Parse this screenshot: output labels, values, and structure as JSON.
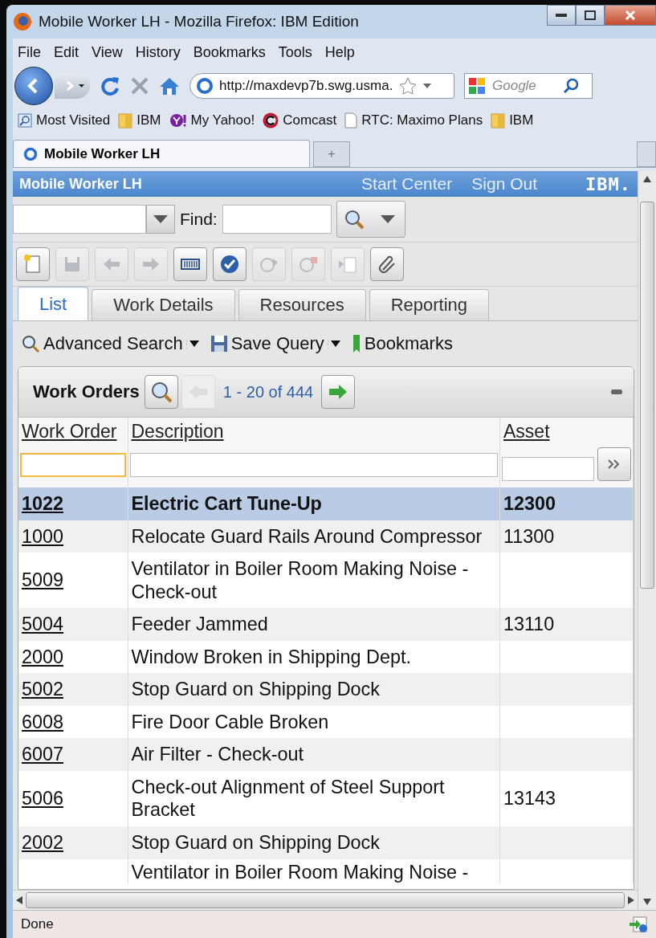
{
  "window": {
    "title": "Mobile Worker LH - Mozilla Firefox: IBM Edition"
  },
  "menu": [
    "File",
    "Edit",
    "View",
    "History",
    "Bookmarks",
    "Tools",
    "Help"
  ],
  "navigation": {
    "url": "http://maxdevp7b.swg.usma.",
    "search_placeholder": "Google"
  },
  "bookmarks": [
    {
      "label": "Most Visited",
      "kind": "smart"
    },
    {
      "label": "IBM",
      "kind": "folder"
    },
    {
      "label": "My Yahoo!",
      "kind": "yahoo"
    },
    {
      "label": "Comcast",
      "kind": "comcast"
    },
    {
      "label": "RTC: Maximo Plans",
      "kind": "page"
    },
    {
      "label": "IBM",
      "kind": "folder"
    }
  ],
  "browser_tab": {
    "title": "Mobile Worker LH",
    "new_tab": "+"
  },
  "app": {
    "title": "Mobile Worker LH",
    "links": [
      "Start Center",
      "Sign Out"
    ],
    "logo": "IBM."
  },
  "find": {
    "label": "Find:"
  },
  "toolbar": [
    {
      "kind": "new",
      "disabled": false
    },
    {
      "kind": "save",
      "disabled": true
    },
    {
      "kind": "back",
      "disabled": true
    },
    {
      "kind": "forward",
      "disabled": true
    },
    {
      "kind": "barcode",
      "disabled": false
    },
    {
      "kind": "check",
      "disabled": false
    },
    {
      "kind": "timer-start",
      "disabled": true
    },
    {
      "kind": "timer-stop",
      "disabled": true
    },
    {
      "kind": "duplicate",
      "disabled": true
    },
    {
      "kind": "attach",
      "disabled": false
    }
  ],
  "tabs": [
    {
      "label": "List",
      "selected": true
    },
    {
      "label": "Work Details",
      "selected": false
    },
    {
      "label": "Resources",
      "selected": false
    },
    {
      "label": "Reporting",
      "selected": false
    }
  ],
  "actions": [
    {
      "label": "Advanced Search",
      "kind": "search"
    },
    {
      "label": "Save Query",
      "kind": "save"
    },
    {
      "label": "Bookmarks",
      "kind": "bookmark"
    }
  ],
  "table": {
    "title": "Work Orders",
    "paging": "1 - 20 of 444",
    "columns": [
      "Work Order",
      "Description",
      "Asset"
    ],
    "rows": [
      {
        "work_order": "1022",
        "description": "Electric Cart Tune-Up",
        "asset": "12300",
        "selected": true
      },
      {
        "work_order": "1000",
        "description": "Relocate Guard Rails Around Compressor",
        "asset": "11300",
        "selected": false
      },
      {
        "work_order": "5009",
        "description": "Ventilator in Boiler Room Making Noise - Check-out",
        "selected": false
      },
      {
        "work_order": "5004",
        "description": "Feeder Jammed",
        "asset": "13110",
        "selected": false
      },
      {
        "work_order": "2000",
        "description": "Window Broken in Shipping Dept.",
        "selected": false
      },
      {
        "work_order": "5002",
        "description": "Stop Guard on Shipping Dock",
        "selected": false
      },
      {
        "work_order": "6008",
        "description": "Fire Door Cable Broken",
        "selected": false
      },
      {
        "work_order": "6007",
        "description": "Air Filter - Check-out",
        "selected": false
      },
      {
        "work_order": "5006",
        "description": "Check-out Alignment of Steel Support Bracket",
        "asset": "13143",
        "selected": false
      },
      {
        "work_order": "2002",
        "description": "Stop Guard on Shipping Dock",
        "selected": false
      },
      {
        "description": "Ventilator in Boiler Room Making Noise -",
        "selected": false
      }
    ]
  },
  "status_bar": {
    "text": "Done"
  }
}
